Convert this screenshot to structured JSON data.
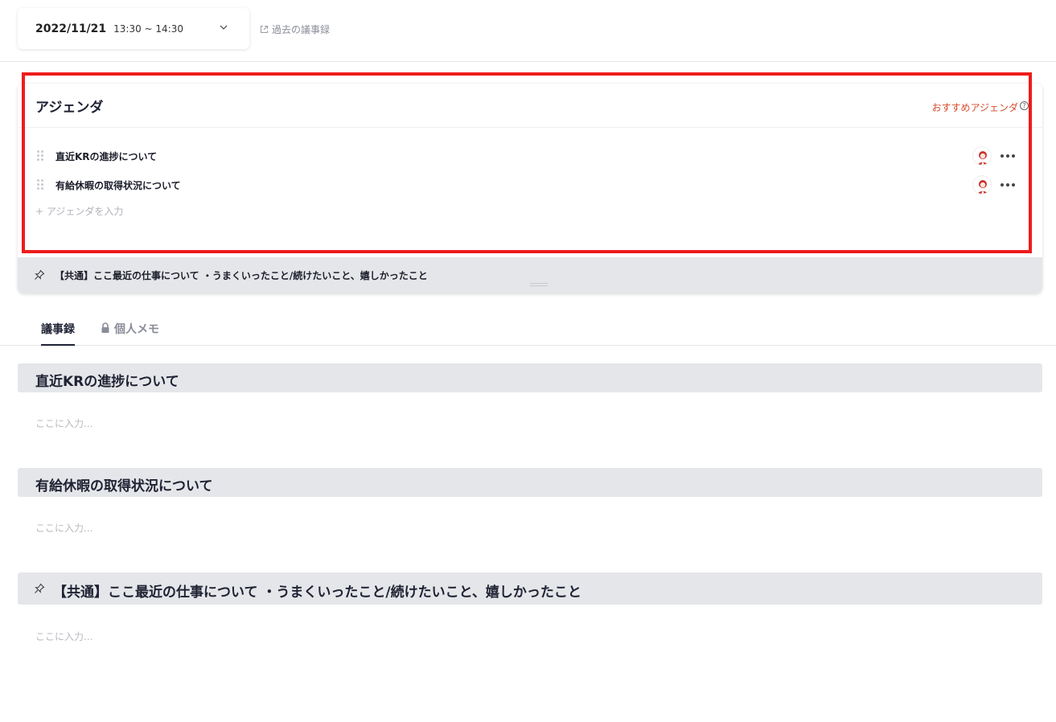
{
  "header": {
    "date": "2022/11/21",
    "time": "13:30 ~ 14:30",
    "past_minutes_link": "過去の議事録"
  },
  "agenda": {
    "title": "アジェンダ",
    "recommend_label": "おすすめアジェンダ",
    "help_glyph": "?",
    "items": [
      {
        "label": "直近KRの進捗について"
      },
      {
        "label": "有給休暇の取得状況について"
      }
    ],
    "add_placeholder": "+ アジェンダを入力",
    "pinned": "【共通】ここ最近の仕事について ・うまくいったこと/続けたいこと、嬉しかったこと"
  },
  "tabs": {
    "minutes": "議事録",
    "memo": "個人メモ"
  },
  "sections": [
    {
      "title": "直近KRの進捗について",
      "placeholder": "ここに入力..."
    },
    {
      "title": "有給休暇の取得状況について",
      "placeholder": "ここに入力..."
    },
    {
      "title": "【共通】ここ最近の仕事について ・うまくいったこと/続けたいこと、嬉しかったこと",
      "placeholder": "ここに入力..."
    }
  ],
  "colors": {
    "accent_red": "#d94a2c",
    "highlight_border": "#ee1c1c",
    "section_bg": "#e5e6e9"
  }
}
